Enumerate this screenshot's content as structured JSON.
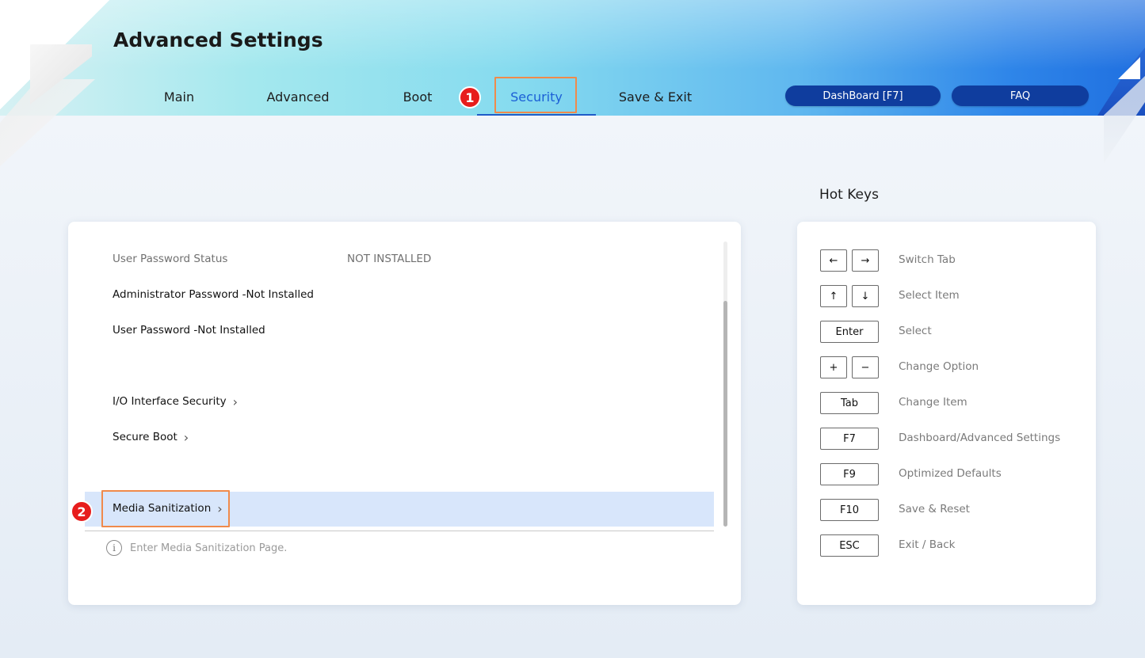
{
  "header": {
    "title": "Advanced Settings",
    "tabs": [
      {
        "label": "Main"
      },
      {
        "label": "Advanced"
      },
      {
        "label": "Boot"
      },
      {
        "label": "Security"
      },
      {
        "label": "Save & Exit"
      }
    ],
    "active_tab": "Security",
    "buttons": {
      "dashboard": "DashBoard [F7]",
      "faq": "FAQ"
    }
  },
  "annotations": {
    "marker1": "1",
    "marker2": "2"
  },
  "security": {
    "rows": [
      {
        "label": "User Password Status",
        "value": "NOT INSTALLED"
      },
      {
        "label": "Administrator Password -Not Installed"
      },
      {
        "label": "User Password -Not Installed"
      },
      {
        "label": "I/O Interface Security"
      },
      {
        "label": "Secure Boot"
      },
      {
        "label": "Media Sanitization"
      }
    ],
    "help_text": "Enter Media Sanitization Page."
  },
  "hotkeys": {
    "title": "Hot Keys",
    "items": [
      {
        "keys": [
          "←",
          "→"
        ],
        "desc": "Switch Tab"
      },
      {
        "keys": [
          "↑",
          "↓"
        ],
        "desc": "Select Item"
      },
      {
        "keys": [
          "Enter"
        ],
        "desc": "Select"
      },
      {
        "keys": [
          "+",
          "−"
        ],
        "desc": "Change Option"
      },
      {
        "keys": [
          "Tab"
        ],
        "desc": "Change Item"
      },
      {
        "keys": [
          "F7"
        ],
        "desc": "Dashboard/Advanced Settings"
      },
      {
        "keys": [
          "F9"
        ],
        "desc": "Optimized Defaults"
      },
      {
        "keys": [
          "F10"
        ],
        "desc": "Save & Reset"
      },
      {
        "keys": [
          "ESC"
        ],
        "desc": "Exit / Back"
      }
    ]
  },
  "colors": {
    "accent": "#1b5fd6",
    "pill": "#0f3d9e",
    "highlight": "#f08a4b",
    "marker": "#e71d1d",
    "selected_row": "#d8e6fb"
  }
}
